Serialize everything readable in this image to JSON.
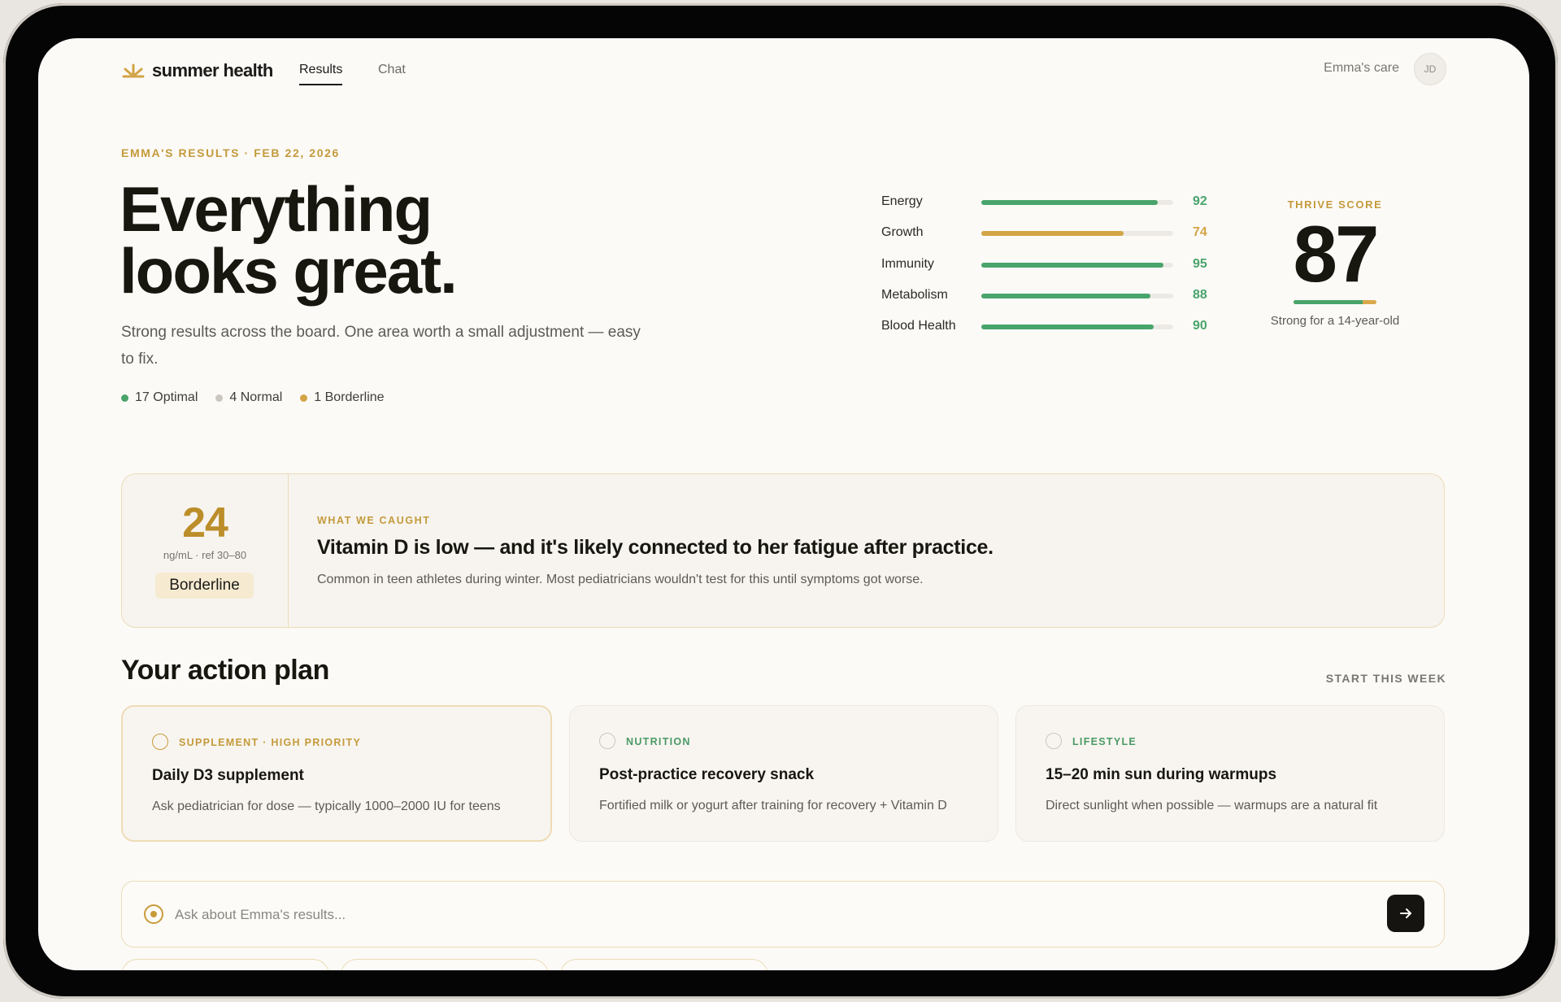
{
  "brand": {
    "name": "summer health",
    "accent": "#c49a3b"
  },
  "nav": {
    "tabs": [
      {
        "label": "Results",
        "active": true
      },
      {
        "label": "Chat",
        "active": false
      }
    ],
    "care_label": "Emma's care",
    "avatar_initials": "JD"
  },
  "hero": {
    "eyebrow": "EMMA'S RESULTS · FEB 22, 2026",
    "title_line1": "Everything",
    "title_line2": "looks great.",
    "subtitle": "Strong results across the board. One area worth a small adjustment — easy to fix.",
    "legend": [
      {
        "label": "17 Optimal",
        "color": "#49a46b"
      },
      {
        "label": "4 Normal",
        "color": "#c9c5bf"
      },
      {
        "label": "1 Borderline",
        "color": "#d2a445"
      }
    ]
  },
  "metrics": [
    {
      "label": "Energy",
      "value": "92",
      "fraction": 0.92,
      "color": "#49a46b"
    },
    {
      "label": "Growth",
      "value": "74",
      "fraction": 0.74,
      "color": "#d2a445"
    },
    {
      "label": "Immunity",
      "value": "95",
      "fraction": 0.95,
      "color": "#49a46b"
    },
    {
      "label": "Metabolism",
      "value": "88",
      "fraction": 0.88,
      "color": "#49a46b"
    },
    {
      "label": "Blood Health",
      "value": "90",
      "fraction": 0.9,
      "color": "#49a46b"
    }
  ],
  "thrive": {
    "label": "THRIVE SCORE",
    "score": "87",
    "fraction": 0.83,
    "note": "Strong for a 14-year-old"
  },
  "caught": {
    "value": "24",
    "ref": "ng/mL · ref 30–80",
    "badge": "Borderline",
    "eyebrow": "WHAT WE CAUGHT",
    "title": "Vitamin D is low — and it's likely connected to her fatigue after practice.",
    "description": "Common in teen athletes during winter. Most pediatricians wouldn't test for this until symptoms got worse."
  },
  "plan": {
    "title": "Your action plan",
    "link": "START THIS WEEK",
    "cards": [
      {
        "tag": "SUPPLEMENT · HIGH PRIORITY",
        "tag_color": "#c49a3b",
        "title": "Daily D3 supplement",
        "description": "Ask pediatrician for dose — typically 1000–2000 IU for teens"
      },
      {
        "tag": "NUTRITION",
        "tag_color": "#4a9a66",
        "title": "Post-practice recovery snack",
        "description": "Fortified milk or yogurt after training for recovery + Vitamin D"
      },
      {
        "tag": "LIFESTYLE",
        "tag_color": "#4a9a66",
        "title": "15–20 min sun during warmups",
        "description": "Direct sunlight when possible — warmups are a natural fit"
      }
    ]
  },
  "ask": {
    "placeholder": "Ask about Emma's results..."
  }
}
